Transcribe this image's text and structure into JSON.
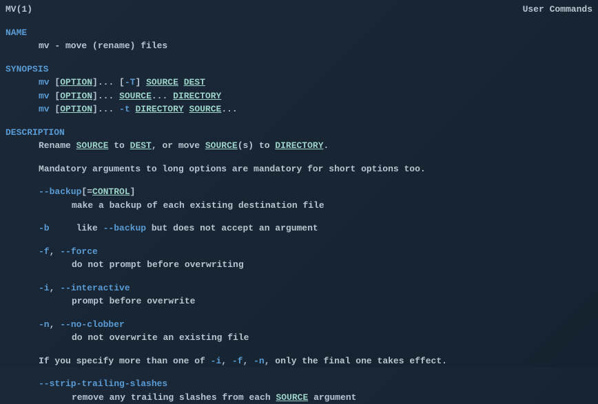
{
  "header": {
    "left": "MV(1)",
    "right": "User Commands"
  },
  "sections": {
    "name": {
      "heading": "NAME",
      "content": "mv - move (rename) files"
    },
    "synopsis": {
      "heading": "SYNOPSIS",
      "lines": [
        {
          "cmd": "mv",
          "opts": "[",
          "var1": "OPTION",
          "mid": "]... [",
          "flag": "-T",
          "mid2": "] ",
          "var2": "SOURCE",
          "sp": " ",
          "var3": "DEST"
        },
        {
          "cmd": "mv",
          "opts": "[",
          "var1": "OPTION",
          "mid": "]... ",
          "var2": "SOURCE",
          "mid2": "... ",
          "var3": "DIRECTORY"
        },
        {
          "cmd": "mv",
          "opts": "[",
          "var1": "OPTION",
          "mid": "]... ",
          "flag": "-t",
          "sp": " ",
          "var2": "DIRECTORY",
          "sp2": " ",
          "var3": "SOURCE",
          "tail": "..."
        }
      ]
    },
    "description": {
      "heading": "DESCRIPTION",
      "para1_pre": "Rename ",
      "para1_src": "SOURCE",
      "para1_mid": " to ",
      "para1_dest": "DEST",
      "para1_mid2": ", or move ",
      "para1_srcs": "SOURCE",
      "para1_mid3": "(s) to ",
      "para1_dir": "DIRECTORY",
      "para1_end": ".",
      "para2": "Mandatory arguments to long options are mandatory for short options too.",
      "options": {
        "backup": {
          "flag": "--backup",
          "bracket_open": "[=",
          "var": "CONTROL",
          "bracket_close": "]",
          "desc": "make a backup of each existing destination file"
        },
        "b": {
          "flag": "-b",
          "desc_pre": "like ",
          "desc_opt": "--backup",
          "desc_post": " but does not accept an argument"
        },
        "force": {
          "flag1": "-f",
          "sep": ", ",
          "flag2": "--force",
          "desc": "do not prompt before overwriting"
        },
        "interactive": {
          "flag1": "-i",
          "sep": ", ",
          "flag2": "--interactive",
          "desc": "prompt before overwrite"
        },
        "noclobber": {
          "flag1": "-n",
          "sep": ", ",
          "flag2": "--no-clobber",
          "desc": "do not overwrite an existing file"
        }
      },
      "note_pre": "If you specify more than one of ",
      "note_i": "-i",
      "note_sep1": ", ",
      "note_f": "-f",
      "note_sep2": ", ",
      "note_n": "-n",
      "note_post": ", only the final one takes effect.",
      "strip": {
        "flag": "--strip-trailing-slashes",
        "desc_pre": "remove any trailing slashes from each ",
        "desc_var": "SOURCE",
        "desc_post": " argument"
      }
    }
  }
}
